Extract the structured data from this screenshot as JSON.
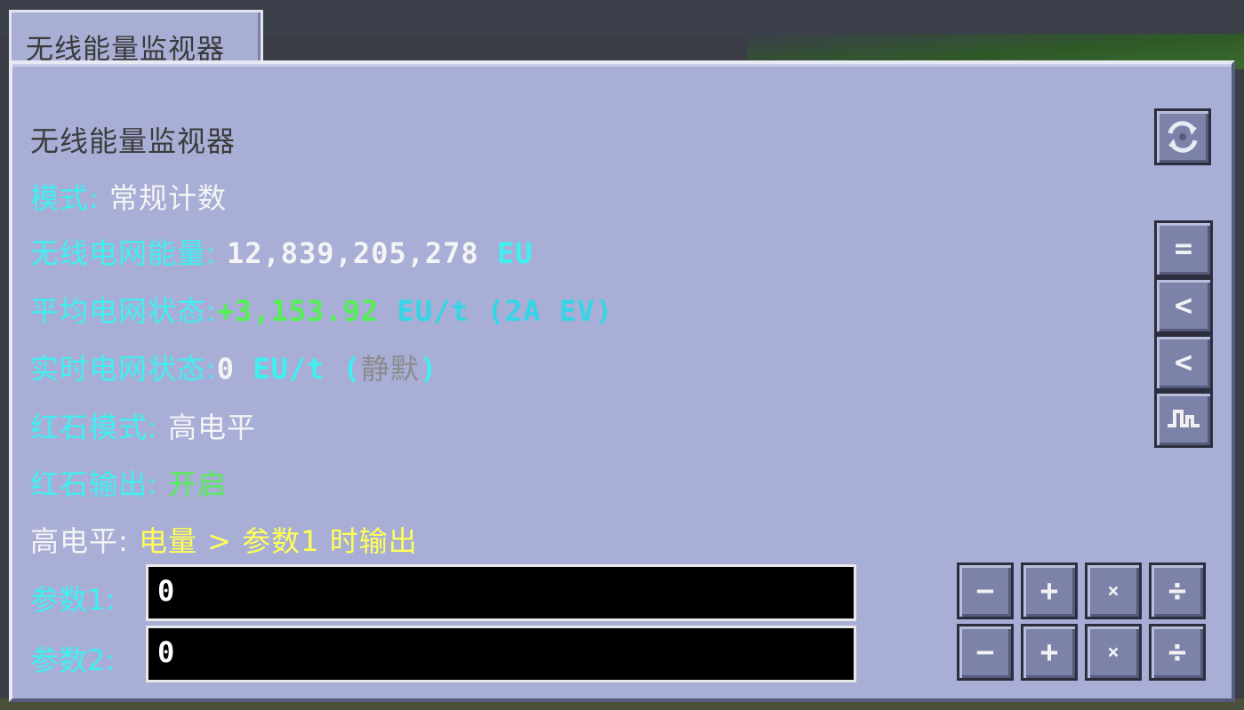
{
  "window": {
    "tab_title": "无线能量监视器"
  },
  "panel": {
    "title": "无线能量监视器",
    "mode": {
      "label": "模式: ",
      "value": "常规计数"
    },
    "network_energy": {
      "label": "无线电网能量: ",
      "value": "12,839,205,278",
      "unit": " EU"
    },
    "avg_status": {
      "label": "平均电网状态:",
      "value": "+3,153.92",
      "unit": " EU/t (2A EV)"
    },
    "realtime_status": {
      "label": "实时电网状态:",
      "value": "0",
      "unit": " EU/t (",
      "state": "静默",
      "close": ")"
    },
    "redstone_mode": {
      "label": "红石模式: ",
      "value": "高电平"
    },
    "redstone_output": {
      "label": "红石输出: ",
      "value": "开启"
    },
    "high_level": {
      "label": "高电平: ",
      "rule": "电量 > 参数1 时输出"
    },
    "param1": {
      "label": "参数1:",
      "value": "0"
    },
    "param2": {
      "label": "参数2:",
      "value": "0"
    }
  },
  "side_buttons": {
    "refresh_icon": "refresh-icon",
    "equals_label": "=",
    "less_label_1": "<",
    "less_label_2": "<",
    "wave_icon": "square-wave-icon"
  },
  "param_ops": {
    "minus": "−",
    "plus": "+",
    "times": "×",
    "divide": "÷"
  }
}
